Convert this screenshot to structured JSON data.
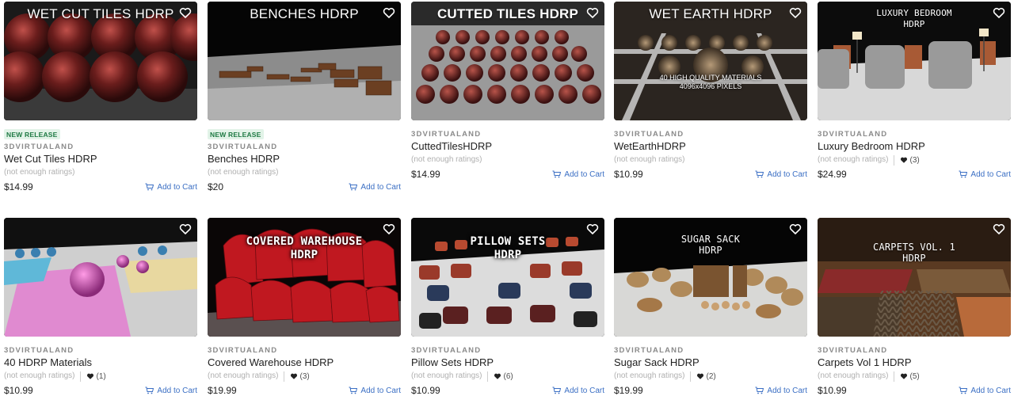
{
  "labels": {
    "not_enough_ratings": "(not enough ratings)",
    "add_to_cart": "Add to Cart",
    "new_release": "NEW RELEASE"
  },
  "products": [
    {
      "thumb_title": "WET CUT TILES HDRP",
      "badge": "NEW RELEASE",
      "publisher": "3DVIRTUALAND",
      "name": "Wet Cut Tiles HDRP",
      "ratings": "(not enough ratings)",
      "favorites": "",
      "price": "$14.99",
      "add_to_cart": "Add to Cart"
    },
    {
      "thumb_title": "BENCHES HDRP",
      "badge": "NEW RELEASE",
      "publisher": "3DVIRTUALAND",
      "name": "Benches HDRP",
      "ratings": "(not enough ratings)",
      "favorites": "",
      "price": "$20",
      "add_to_cart": "Add to Cart"
    },
    {
      "thumb_title": "CUTTED TILES HDRP",
      "badge": "",
      "publisher": "3DVIRTUALAND",
      "name": "CuttedTilesHDRP",
      "ratings": "(not enough ratings)",
      "favorites": "",
      "price": "$14.99",
      "add_to_cart": "Add to Cart"
    },
    {
      "thumb_title": "WET EARTH HDRP",
      "thumb_subtitle": [
        "40 HIGH QUALITY MATERIALS",
        "4096x4096 PIXELS"
      ],
      "badge": "",
      "publisher": "3DVIRTUALAND",
      "name": "WetEarthHDRP",
      "ratings": "(not enough ratings)",
      "favorites": "",
      "price": "$10.99",
      "add_to_cart": "Add to Cart"
    },
    {
      "thumb_title": "LUXURY BEDROOM",
      "thumb_title_2": "HDRP",
      "badge": "",
      "publisher": "3DVIRTUALAND",
      "name": "Luxury Bedroom HDRP",
      "ratings": "(not enough ratings)",
      "favorites": "(3)",
      "price": "$24.99",
      "add_to_cart": "Add to Cart"
    },
    {
      "thumb_title": "",
      "badge": "",
      "publisher": "3DVIRTUALAND",
      "name": "40 HDRP Materials",
      "ratings": "(not enough ratings)",
      "favorites": "(1)",
      "price": "$10.99",
      "add_to_cart": "Add to Cart"
    },
    {
      "thumb_title": "COVERED WAREHOUSE",
      "thumb_title_2": "HDRP",
      "badge": "",
      "publisher": "3DVIRTUALAND",
      "name": "Covered Warehouse HDRP",
      "ratings": "(not enough ratings)",
      "favorites": "(3)",
      "price": "$19.99",
      "add_to_cart": "Add to Cart"
    },
    {
      "thumb_title": "PILLOW SETS",
      "thumb_title_2": "HDRP",
      "badge": "",
      "publisher": "3DVIRTUALAND",
      "name": "Pillow Sets HDRP",
      "ratings": "(not enough ratings)",
      "favorites": "(6)",
      "price": "$10.99",
      "add_to_cart": "Add to Cart"
    },
    {
      "thumb_title": "SUGAR SACK",
      "thumb_title_2": "HDRP",
      "badge": "",
      "publisher": "3DVIRTUALAND",
      "name": "Sugar Sack HDRP",
      "ratings": "(not enough ratings)",
      "favorites": "(2)",
      "price": "$19.99",
      "add_to_cart": "Add to Cart"
    },
    {
      "thumb_title": "CARPETS VOL. 1",
      "thumb_title_2": "HDRP",
      "badge": "",
      "publisher": "3DVIRTUALAND",
      "name": "Carpets Vol 1 HDRP",
      "ratings": "(not enough ratings)",
      "favorites": "(5)",
      "price": "$10.99",
      "add_to_cart": "Add to Cart"
    }
  ],
  "colors": {
    "accent_link": "#3b6fc4",
    "badge_bg": "#e2f3e8",
    "badge_text": "#1f7a44",
    "muted": "#b0b0b0"
  },
  "icons": {
    "wishlist": "heart-outline-icon",
    "favorites": "heart-filled-icon",
    "cart": "cart-icon"
  }
}
